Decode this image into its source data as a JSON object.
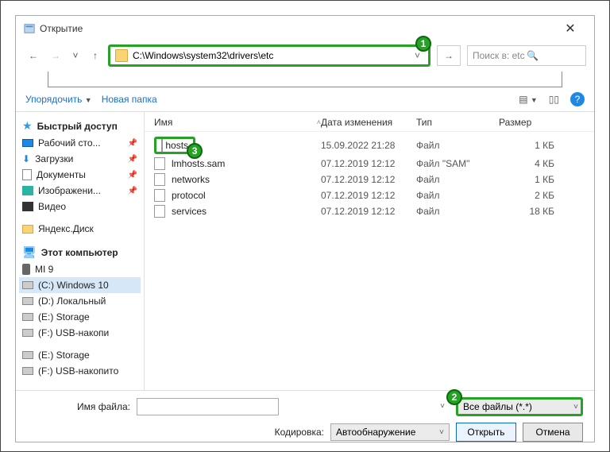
{
  "title": "Открытие",
  "address_path": "C:\\Windows\\system32\\drivers\\etc",
  "search_placeholder": "Поиск в: etc",
  "toolbar": {
    "organize": "Упорядочить",
    "new_folder": "Новая папка"
  },
  "sidebar": {
    "quick_access": "Быстрый доступ",
    "items_qa": [
      {
        "label": "Рабочий сто..."
      },
      {
        "label": "Загрузки"
      },
      {
        "label": "Документы"
      },
      {
        "label": "Изображени..."
      },
      {
        "label": "Видео"
      }
    ],
    "yadisk": "Яндекс.Диск",
    "this_pc": "Этот компьютер",
    "items_pc": [
      {
        "label": "MI 9"
      },
      {
        "label": "(C:) Windows 10"
      },
      {
        "label": "(D:) Локальный"
      },
      {
        "label": "(E:) Storage"
      },
      {
        "label": "(F:) USB-накопи"
      }
    ],
    "extra": [
      {
        "label": "(E:) Storage"
      },
      {
        "label": "(F:) USB-накопито"
      }
    ]
  },
  "columns": {
    "name": "Имя",
    "date": "Дата изменения",
    "type": "Тип",
    "size": "Размер"
  },
  "files": [
    {
      "name": "hosts",
      "date": "15.09.2022 21:28",
      "type": "Файл",
      "size": "1 КБ"
    },
    {
      "name": "lmhosts.sam",
      "date": "07.12.2019 12:12",
      "type": "Файл \"SAM\"",
      "size": "4 КБ"
    },
    {
      "name": "networks",
      "date": "07.12.2019 12:12",
      "type": "Файл",
      "size": "1 КБ"
    },
    {
      "name": "protocol",
      "date": "07.12.2019 12:12",
      "type": "Файл",
      "size": "2 КБ"
    },
    {
      "name": "services",
      "date": "07.12.2019 12:12",
      "type": "Файл",
      "size": "18 КБ"
    }
  ],
  "bottom": {
    "filename_label": "Имя файла:",
    "filetype_label": "Все файлы  (*.*)",
    "encoding_label": "Кодировка:",
    "encoding_value": "Автообнаружение",
    "open": "Открыть",
    "cancel": "Отмена"
  },
  "badges": {
    "b1": "1",
    "b2": "2",
    "b3": "3"
  }
}
